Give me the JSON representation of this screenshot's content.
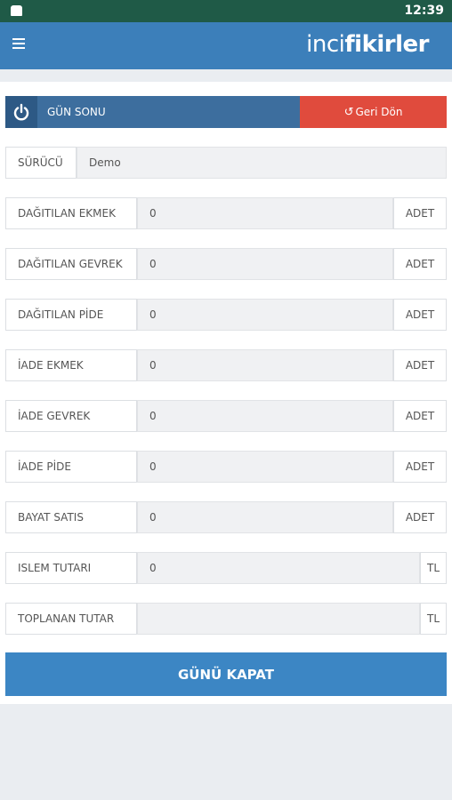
{
  "status_bar": {
    "time": "12:39"
  },
  "app_bar": {
    "brand_light": "inci",
    "brand_bold": "fikirler"
  },
  "header": {
    "title": "GÜN SONU",
    "back_label": "Geri Dön"
  },
  "driver": {
    "label": "SÜRÜCÜ",
    "value": "Demo"
  },
  "rows": [
    {
      "label": "DAĞITILAN EKMEK",
      "value": "0",
      "unit": "ADET"
    },
    {
      "label": "DAĞITILAN GEVREK",
      "value": "0",
      "unit": "ADET"
    },
    {
      "label": "DAĞITILAN PİDE",
      "value": "0",
      "unit": "ADET"
    },
    {
      "label": "İADE EKMEK",
      "value": "0",
      "unit": "ADET"
    },
    {
      "label": "İADE GEVREK",
      "value": "0",
      "unit": "ADET"
    },
    {
      "label": "İADE PİDE",
      "value": "0",
      "unit": "ADET"
    },
    {
      "label": "BAYAT SATIS",
      "value": "0",
      "unit": "ADET"
    },
    {
      "label": "ISLEM TUTARI",
      "value": "0",
      "unit": "TL"
    },
    {
      "label": "TOPLANAN TUTAR",
      "value": "",
      "unit": "TL"
    }
  ],
  "close_button": {
    "label": "GÜNÜ KAPAT"
  },
  "colors": {
    "status_bar": "#1f5a47",
    "app_bar": "#3c7fba",
    "header": "#3d6e9e",
    "back_button": "#e04b3d",
    "close_button": "#3c86c4"
  }
}
